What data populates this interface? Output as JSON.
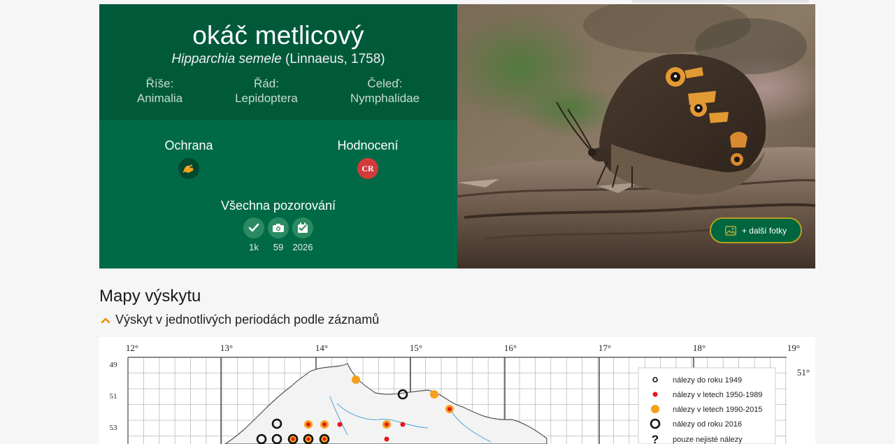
{
  "species": {
    "common_name": "okáč metlicový",
    "scientific_name": "Hipparchia semele",
    "authority": "(Linnaeus, 1758)"
  },
  "taxonomy": [
    {
      "label": "Říše:",
      "value": "Animalia"
    },
    {
      "label": "Řád:",
      "value": "Lepidoptera"
    },
    {
      "label": "Čeleď:",
      "value": "Nymphalidae"
    }
  ],
  "status": {
    "protection_label": "Ochrana",
    "rating_label": "Hodnocení",
    "rating_value": "CR",
    "observations_label": "Všechna pozorování",
    "observations": [
      {
        "icon": "check-icon",
        "value": "1k"
      },
      {
        "icon": "camera-icon",
        "value": "59"
      },
      {
        "icon": "calendar-icon",
        "value": "2026"
      }
    ]
  },
  "photo": {
    "more_photos_label": "+ další fotky"
  },
  "maps": {
    "title": "Mapy výskytu",
    "subsection_label": "Výskyt v jednotlivých periodách podle záznamů",
    "longitudes": [
      "12°",
      "13°",
      "14°",
      "15°",
      "16°",
      "17°",
      "18°",
      "19°"
    ],
    "row_labels": [
      "49",
      "51",
      "53"
    ],
    "latitude_label": "51°",
    "legend": [
      {
        "symbol": "o",
        "text": "nálezy do roku 1949"
      },
      {
        "symbol": "red-dot",
        "text": "nálezy v letech 1950-1989"
      },
      {
        "symbol": "orange-dot",
        "text": "nálezy v letech 1990-2015"
      },
      {
        "symbol": "O",
        "text": "nálezy od roku 2016"
      },
      {
        "symbol": "?",
        "text": "pouze nejisté nálezy"
      }
    ],
    "colors": {
      "red": "#e8141b",
      "orange": "#f5a01a"
    }
  }
}
